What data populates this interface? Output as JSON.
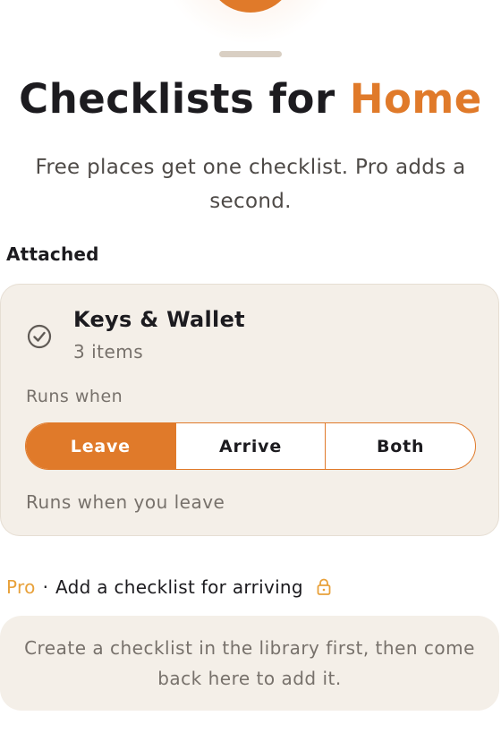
{
  "header": {
    "title_prefix": "Checklists for ",
    "title_place": "Home",
    "subtitle": "Free places get one checklist. Pro adds a second."
  },
  "attached": {
    "section_label": "Attached",
    "checklist": {
      "name": "Keys & Wallet",
      "item_count": "3 items",
      "icon": "checkmark-circle-icon"
    },
    "runs_when_label": "Runs when",
    "options": [
      "Leave",
      "Arrive",
      "Both"
    ],
    "selected_option": "Leave",
    "runs_note": "Runs when you leave"
  },
  "pro_section": {
    "badge": "Pro",
    "separator": "·",
    "label": "Add a checklist for arriving",
    "icon": "lock-icon",
    "empty_message": "Create a checklist in the library first, then come back here to add it."
  },
  "colors": {
    "accent": "#e07a2a",
    "pro": "#e8a13a",
    "card_bg": "#f4efe8",
    "muted_text": "#77716b"
  }
}
